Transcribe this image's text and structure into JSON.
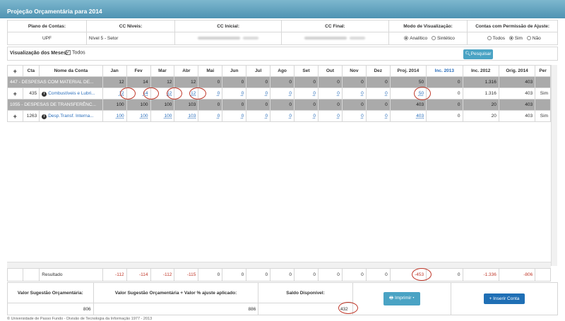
{
  "title": "Projeção Orçamentária para 2014",
  "filters": {
    "plano_label": "Plano de Contas:",
    "plano_value": "UPF",
    "niveis_label": "CC Níveis:",
    "niveis_value": "Nível 5 - Setor",
    "inicial_label": "CC Inicial:",
    "final_label": "CC Final:",
    "modo_label": "Modo de Visualização:",
    "modo_opt1": "Analítico",
    "modo_opt2": "Sintético",
    "modo_selected": "Analítico",
    "ajuste_label": "Contas com Permissão de Ajuste:",
    "ajuste_opt1": "Todos",
    "ajuste_opt2": "Sim",
    "ajuste_opt3": "Não",
    "ajuste_selected": "Sim"
  },
  "meses": {
    "label": "Visualização dos Meses:",
    "todos": "Todos",
    "checked": true
  },
  "buttons": {
    "pesquisar": "Pesquisar",
    "imprimir": "Imprimir",
    "inserir": "Inserir Conta"
  },
  "columns": [
    "Cta",
    "Nome da Conta",
    "Jan",
    "Fev",
    "Mar",
    "Abr",
    "Mai",
    "Jun",
    "Jul",
    "Ago",
    "Set",
    "Out",
    "Nov",
    "Dez",
    "Proj. 2014",
    "Inc. 2013",
    "Inc. 2012",
    "Orig. 2014",
    "Per"
  ],
  "rows": [
    {
      "cta": "",
      "nome": "447 - DESPESAS COM MATERIAL DE...",
      "jan": "12",
      "fev": "14",
      "mar": "12",
      "abr": "12",
      "mai": "0",
      "jun": "0",
      "jul": "0",
      "ago": "0",
      "set": "0",
      "out": "0",
      "nov": "0",
      "dez": "0",
      "proj": "50",
      "inc13": "0",
      "inc12": "1.316",
      "orig": "403",
      "per": ""
    },
    {
      "cta": "435",
      "nome": "Combustíveis e Lubri...",
      "jan": "12",
      "fev": "14",
      "mar": "12",
      "abr": "12",
      "mai": "0",
      "jun": "0",
      "jul": "0",
      "ago": "0",
      "set": "0",
      "out": "0",
      "nov": "0",
      "dez": "0",
      "proj": "50",
      "inc13": "0",
      "inc12": "1.316",
      "orig": "403",
      "per": "Sim"
    },
    {
      "cta": "",
      "nome": "1055 - DESPESAS DE TRANSFERÊNC...",
      "jan": "100",
      "fev": "100",
      "mar": "100",
      "abr": "103",
      "mai": "0",
      "jun": "0",
      "jul": "0",
      "ago": "0",
      "set": "0",
      "out": "0",
      "nov": "0",
      "dez": "0",
      "proj": "403",
      "inc13": "0",
      "inc12": "20",
      "orig": "403",
      "per": ""
    },
    {
      "cta": "1263",
      "nome": "Desp.Transf. Interna...",
      "jan": "100",
      "fev": "100",
      "mar": "100",
      "abr": "103",
      "mai": "0",
      "jun": "0",
      "jul": "0",
      "ago": "0",
      "set": "0",
      "out": "0",
      "nov": "0",
      "dez": "0",
      "proj": "403",
      "inc13": "0",
      "inc12": "20",
      "orig": "403",
      "per": "Sim"
    }
  ],
  "result": {
    "label": "Resultado",
    "values": [
      "-112",
      "-114",
      "-112",
      "-115",
      "0",
      "0",
      "0",
      "0",
      "0",
      "0",
      "0",
      "0",
      "-453",
      "0",
      "-1.336",
      "-806"
    ]
  },
  "footer": {
    "sugestao_label": "Valor Sugestão Orçamentária:",
    "sugestao_value": "806",
    "ajuste_label": "Valor Sugestão Orçamentária + Valor % ajuste aplicado:",
    "ajuste_value": "886",
    "saldo_label": "Saldo Disponível:",
    "saldo_value": "432"
  },
  "copyright": "© Universidade de Passo Fundo - Divisão de Tecnologia da Informação 1977 - 2013",
  "colors": {
    "header": "#4f93b2",
    "group_row": "#aaaaaa",
    "link": "#2a6ebb",
    "negative": "#c0392b",
    "button_blue": "#1f6fb5",
    "button_teal": "#4aa3c4"
  }
}
